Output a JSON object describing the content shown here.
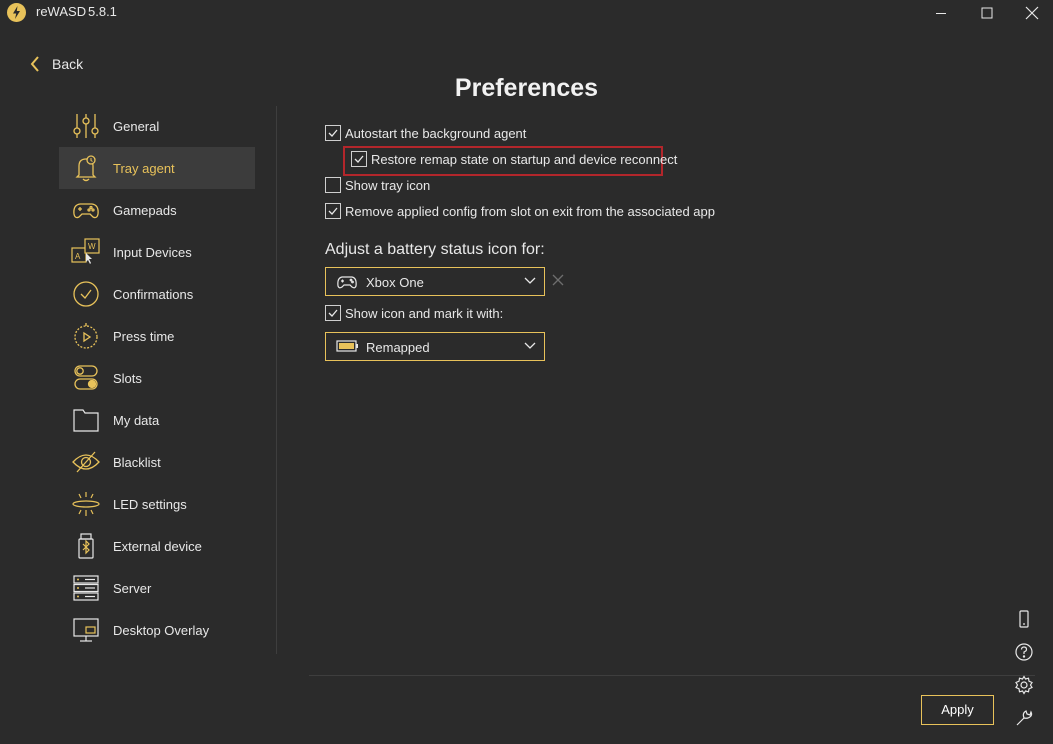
{
  "titlebar": {
    "app_name": "reWASD",
    "version": "5.8.1"
  },
  "nav": {
    "back_label": "Back"
  },
  "page": {
    "title": "Preferences"
  },
  "sidebar": {
    "items": [
      {
        "label": "General",
        "icon": "sliders-icon"
      },
      {
        "label": "Tray agent",
        "icon": "bell-icon",
        "active": true
      },
      {
        "label": "Gamepads",
        "icon": "gamepad-icon"
      },
      {
        "label": "Input Devices",
        "icon": "keyboard-mouse-icon"
      },
      {
        "label": "Confirmations",
        "icon": "check-circle-icon"
      },
      {
        "label": "Press time",
        "icon": "stopwatch-icon"
      },
      {
        "label": "Slots",
        "icon": "toggles-icon"
      },
      {
        "label": "My data",
        "icon": "folder-icon"
      },
      {
        "label": "Blacklist",
        "icon": "eye-off-icon"
      },
      {
        "label": "LED settings",
        "icon": "led-icon"
      },
      {
        "label": "External device",
        "icon": "bluetooth-usb-icon"
      },
      {
        "label": "Server",
        "icon": "server-icon"
      },
      {
        "label": "Desktop Overlay",
        "icon": "monitor-icon"
      }
    ]
  },
  "tray": {
    "autostart": {
      "label": "Autostart the background agent",
      "checked": true
    },
    "restore": {
      "label": "Restore remap state on startup and device reconnect",
      "checked": true
    },
    "show_tray": {
      "label": "Show tray icon",
      "checked": false
    },
    "remove_config": {
      "label": "Remove applied config from slot on exit from the associated app",
      "checked": true
    },
    "battery_title": "Adjust a battery status icon for:",
    "device_select": {
      "value": "Xbox One",
      "icon": "xbox-controller-icon"
    },
    "show_icon": {
      "label": "Show icon and mark it with:",
      "checked": true
    },
    "mark_select": {
      "value": "Remapped",
      "icon": "battery-icon"
    }
  },
  "footer": {
    "apply_label": "Apply"
  },
  "colors": {
    "accent": "#e8c25a",
    "background": "#2b2b2b",
    "active_bg": "#3c3c3c",
    "highlight": "#b3262b"
  },
  "toolbar_icons": [
    "device-icon",
    "help-icon",
    "settings-icon",
    "wrench-icon"
  ]
}
